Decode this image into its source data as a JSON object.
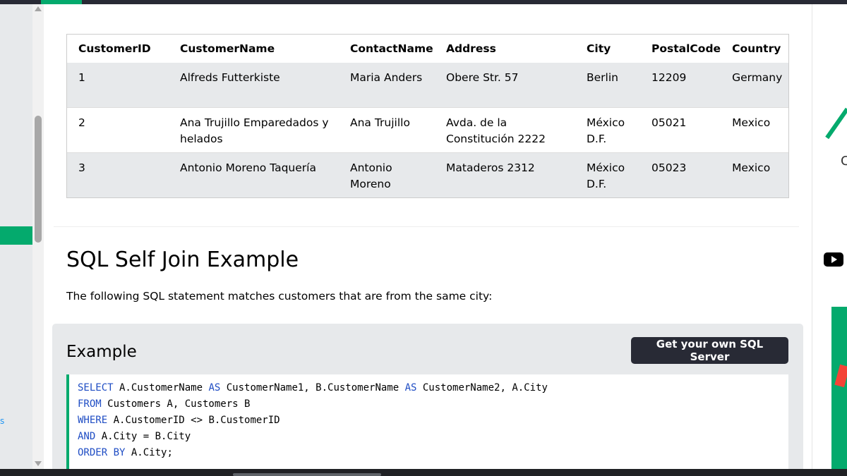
{
  "colors": {
    "accent": "#04aa6d",
    "dark": "#282a35",
    "panel": "#e7e9eb",
    "keyword": "#1f4dc4"
  },
  "table": {
    "headers": [
      "CustomerID",
      "CustomerName",
      "ContactName",
      "Address",
      "City",
      "PostalCode",
      "Country"
    ],
    "rows": [
      [
        "1",
        "Alfreds Futterkiste",
        "Maria Anders",
        "Obere Str. 57",
        "Berlin",
        "12209",
        "Germany"
      ],
      [
        "2",
        "Ana Trujillo Emparedados y helados",
        "Ana Trujillo",
        "Avda. de la Constitución 2222",
        "México D.F.",
        "05021",
        "Mexico"
      ],
      [
        "3",
        "Antonio Moreno Taquería",
        "Antonio Moreno",
        "Mataderos 2312",
        "México D.F.",
        "05023",
        "Mexico"
      ]
    ]
  },
  "section": {
    "title": "SQL Self Join Example",
    "intro": "The following SQL statement matches customers that are from the same city:"
  },
  "example": {
    "title": "Example",
    "button": "Get your own SQL Server",
    "code": {
      "l1_kw1": "SELECT",
      "l1_t1": " A.CustomerName ",
      "l1_kw2": "AS",
      "l1_t2": " CustomerName1, B.CustomerName ",
      "l1_kw3": "AS",
      "l1_t3": " CustomerName2, A.City",
      "l2_kw": "FROM",
      "l2_t": " Customers A, Customers B",
      "l3_kw": "WHERE",
      "l3_t": " A.CustomerID <> B.CustomerID",
      "l4_kw": "AND",
      "l4_t": " A.City = B.City",
      "l5_kw": "ORDER BY",
      "l5_t": " A.City;"
    }
  },
  "right_rail": {
    "partial_letter": "C"
  },
  "left_sidebar": {
    "partial_glyph": "s"
  },
  "icons": {
    "scroll_up": "triangle-up",
    "scroll_down": "triangle-down",
    "youtube": "youtube-icon"
  }
}
